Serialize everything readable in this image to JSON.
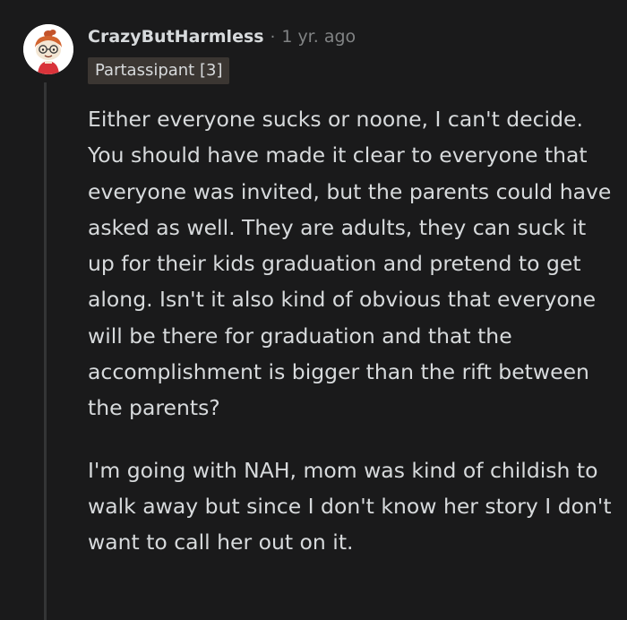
{
  "comment": {
    "username": "CrazyButHarmless",
    "separator": "·",
    "timestamp": "1 yr. ago",
    "flair": "Partassipant [3]",
    "paragraphs": [
      "Either everyone sucks or noone, I can't decide. You should have made it clear to everyone that everyone was invited, but the parents could have asked as well. They are adults, they can suck it up for their kids graduation and pretend to get along. Isn't it also kind of obvious that everyone will be there for graduation and that the accomplishment is bigger than the rift between the parents?",
      "I'm going with NAH, mom was kind of childish to walk away but since I don't know her story I don't want to call her out on it."
    ]
  },
  "colors": {
    "background": "#1a1a1b",
    "text": "#d7dadc",
    "muted": "#818384",
    "flair_bg": "#3b3632",
    "thread_line": "#343536"
  },
  "icons": {
    "avatar": "snoo-avatar-red-hair-glasses"
  }
}
